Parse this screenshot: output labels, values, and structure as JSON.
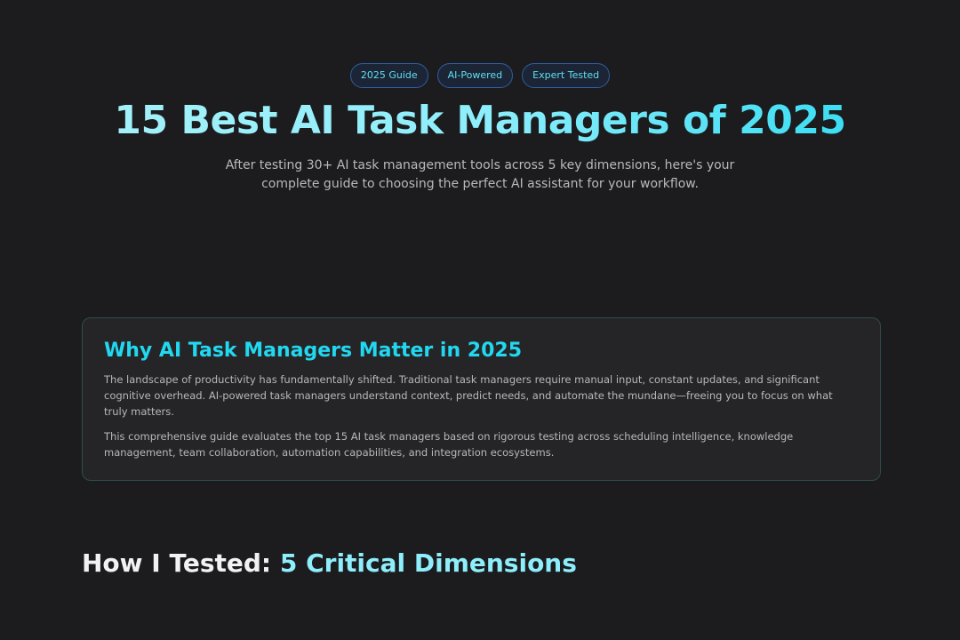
{
  "hero": {
    "badges": [
      "2025 Guide",
      "AI-Powered",
      "Expert Tested"
    ],
    "title": "15 Best AI Task Managers of 2025",
    "subtitle": "After testing 30+ AI task management tools across 5 key dimensions, here's your complete guide to choosing the perfect AI assistant for your workflow."
  },
  "intro_card": {
    "title": "Why AI Task Managers Matter in 2025",
    "paragraphs": [
      "The landscape of productivity has fundamentally shifted. Traditional task managers require manual input, constant updates, and significant cognitive overhead. AI-powered task managers understand context, predict needs, and automate the mundane—freeing you to focus on what truly matters.",
      "This comprehensive guide evaluates the top 15 AI task managers based on rigorous testing across scheduling intelligence, knowledge management, team collaboration, automation capabilities, and integration ecosystems."
    ]
  },
  "section": {
    "title_lead": "How I Tested: ",
    "title_accent": "5 Critical Dimensions"
  },
  "colors": {
    "background": "#1c1c1e",
    "accent": "#22d8f0",
    "accent_light": "#8eeefb",
    "card_bg": "#252528",
    "card_border": "#2f4b4c",
    "badge_border": "#2f5d9e"
  }
}
